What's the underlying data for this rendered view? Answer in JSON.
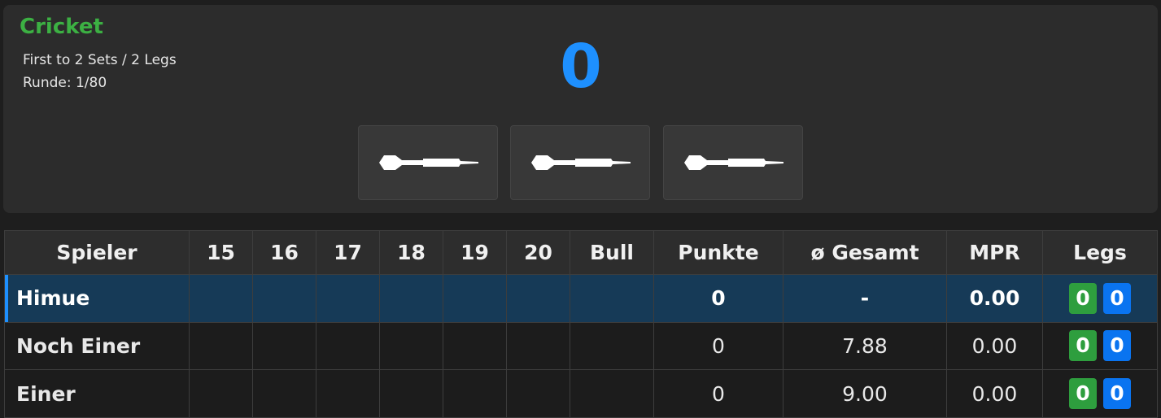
{
  "header": {
    "game_title": "Cricket",
    "format": "First to 2 Sets / 2 Legs",
    "round": "Runde: 1/80",
    "current_score": "0",
    "dart_slots": [
      "dart-icon",
      "dart-icon",
      "dart-icon"
    ]
  },
  "table": {
    "columns": [
      "Spieler",
      "15",
      "16",
      "17",
      "18",
      "19",
      "20",
      "Bull",
      "Punkte",
      "ø Gesamt",
      "MPR",
      "Legs"
    ],
    "rows": [
      {
        "name": "Himue",
        "marks": [
          "",
          "",
          "",
          "",
          "",
          "",
          ""
        ],
        "points": "0",
        "avg": "-",
        "mpr": "0.00",
        "sets": "0",
        "legs": "0",
        "active": true
      },
      {
        "name": "Noch Einer",
        "marks": [
          "",
          "",
          "",
          "",
          "",
          "",
          ""
        ],
        "points": "0",
        "avg": "7.88",
        "mpr": "0.00",
        "sets": "0",
        "legs": "0",
        "active": false
      },
      {
        "name": "Einer",
        "marks": [
          "",
          "",
          "",
          "",
          "",
          "",
          ""
        ],
        "points": "0",
        "avg": "9.00",
        "mpr": "0.00",
        "sets": "0",
        "legs": "0",
        "active": false
      }
    ]
  },
  "colors": {
    "accent_green": "#3cb043",
    "accent_blue": "#1e90ff",
    "active_row": "#163a57"
  }
}
